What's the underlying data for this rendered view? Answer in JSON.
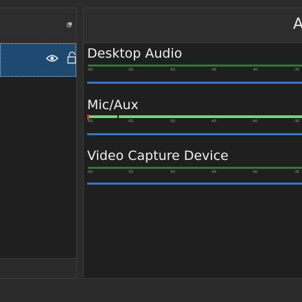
{
  "mixer": {
    "title": "A",
    "ticks": [
      "-60",
      "-55",
      "-50",
      "-45",
      "-40",
      "-35"
    ],
    "channels": [
      {
        "name": "Desktop Audio",
        "level_active": false
      },
      {
        "name": "Mic/Aux",
        "level_active": true
      },
      {
        "name": "Video Capture Device",
        "level_active": false
      }
    ]
  },
  "colors": {
    "selected_row": "#1e4a72",
    "fader": "#2f7ad0",
    "meter": "#66e066",
    "peak": "#e03030"
  }
}
